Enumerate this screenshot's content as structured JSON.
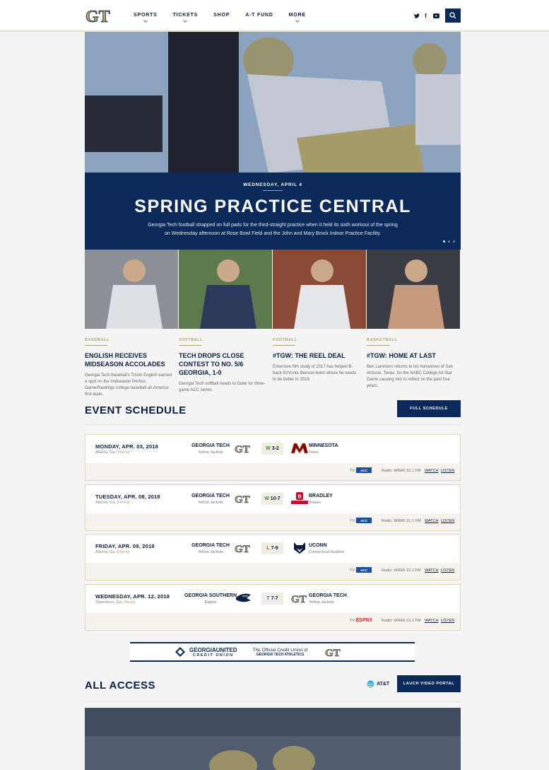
{
  "colors": {
    "navy": "#0b2a5a",
    "gold": "#b3a369",
    "win": "#3d8b2e",
    "loss": "#c0392b"
  },
  "header": {
    "logo_text": "GT",
    "nav": [
      {
        "label": "SPORTS",
        "dropdown": true
      },
      {
        "label": "TICKETS",
        "dropdown": true
      },
      {
        "label": "SHOP",
        "dropdown": false
      },
      {
        "label": "A-T FUND",
        "dropdown": false
      },
      {
        "label": "MORE",
        "dropdown": true
      }
    ],
    "social": [
      "twitter-icon",
      "facebook-icon",
      "youtube-icon"
    ],
    "search_icon": "search-icon"
  },
  "hero": {
    "date": "WEDNESDAY, APRIL 4",
    "title": "SPRING PRACTICE CENTRAL",
    "description": "Georgia Tech football strapped on full pads for the third-straight practice when it held its sixth workout of the spring on Wednesday afternoon at Rose Bowl Field and the John and Mary Brock Indoor Practice Facility.",
    "slides": 3,
    "active_slide": 1
  },
  "cards": [
    {
      "category": "BASEBALL",
      "title": "ENGLISH RECEIVES MIDSEASON ACCOLADES",
      "desc": "Georgia Tech baseball's Tristin English earned a spot on the midseason Perfect Game/Rawlings college baseball all-America first team."
    },
    {
      "category": "SOFTBALL",
      "title": "TECH DROPS CLOSE CONTEST TO NO. 5/6 GEORGIA, 1-0",
      "desc": "Georgia Tech softball heads to Duke for three-game ACC series."
    },
    {
      "category": "FOOTBALL",
      "title": "#TGW: THE REEL DEAL",
      "desc": "Extensive film study of 2017 has helped B-back KirVonte Benson learn where he needs to be better in 2018."
    },
    {
      "category": "BASKETBALL",
      "title": "#TGW: HOME AT LAST",
      "desc": "Ben Lammers returns to his hometown of San Antonio, Texas, for the NABC College All-Star Game causing him to reflect on the past four years."
    }
  ],
  "schedule": {
    "title": "EVENT SCHEDULE",
    "full_button": "FULL SCHEDULE",
    "events": [
      {
        "date": "MONDAY, APR. 03, 2018",
        "loc": "Atlanta, Ga.",
        "site": "[Home]",
        "team1": "GEORGIA TECH",
        "team1_sub": "Yellow Jackets",
        "result": "W",
        "score": "3-2",
        "team2": "MINNESOTA",
        "team2_sub": "Twins",
        "tv": "TV:",
        "net": "ACC",
        "radio": "Radio: WREK 91.1 FM",
        "watch": "WATCH",
        "listen": "LISTEN",
        "t2logo": "minnesota-logo"
      },
      {
        "date": "TUESDAY, APR. 08, 2018",
        "loc": "Atlanta, Ga.",
        "site": "[Home]",
        "team1": "GEORGIA TECH",
        "team1_sub": "Yellow Jackets",
        "result": "W",
        "score": "10-7",
        "team2": "BRADLEY",
        "team2_sub": "Braves",
        "tv": "TV:",
        "net": "ACC",
        "radio": "Radio: WREK 91.1 FM",
        "watch": "WATCH",
        "listen": "LISTEN",
        "t2logo": "bradley-logo"
      },
      {
        "date": "FRIDAY, APR. 09, 2018",
        "loc": "Atlanta, Ga.",
        "site": "[Home]",
        "team1": "GEORGIA TECH",
        "team1_sub": "Yellow Jackets",
        "result": "L",
        "score": "7-9",
        "team2": "UCONN",
        "team2_sub": "Connecticut Huskies",
        "tv": "TV:",
        "net": "ACC",
        "radio": "Radio: WREK 91.1 FM",
        "watch": "WATCH",
        "listen": "LISTEN",
        "t2logo": "uconn-logo"
      },
      {
        "date": "WEDNESDAY, APR. 12, 2018",
        "loc": "Statesboro, Ga.",
        "site": "[Away]",
        "team1": "GEORGIA SOUTHERN",
        "team1_sub": "Eagles",
        "result": "T",
        "score": "7-7",
        "team2": "GEORGIA TECH",
        "team2_sub": "Yellow Jackets",
        "tv": "TV:",
        "net": "ESPN3",
        "radio": "Radio: WREK 91.1 FM",
        "watch": "WATCH",
        "listen": "LISTEN",
        "t2logo": "gt-logo"
      }
    ]
  },
  "ad": {
    "brand": "GEORGIAUNITED",
    "brand_sub": "CREDIT UNION",
    "tagline1": "The Official Credit Union of",
    "tagline2": "GEORGIA TECH ATHLETICS"
  },
  "all_access": {
    "title": "ALL ACCESS",
    "sponsor": "AT&T",
    "button": "LAUCH VIDEO PORTAL"
  }
}
